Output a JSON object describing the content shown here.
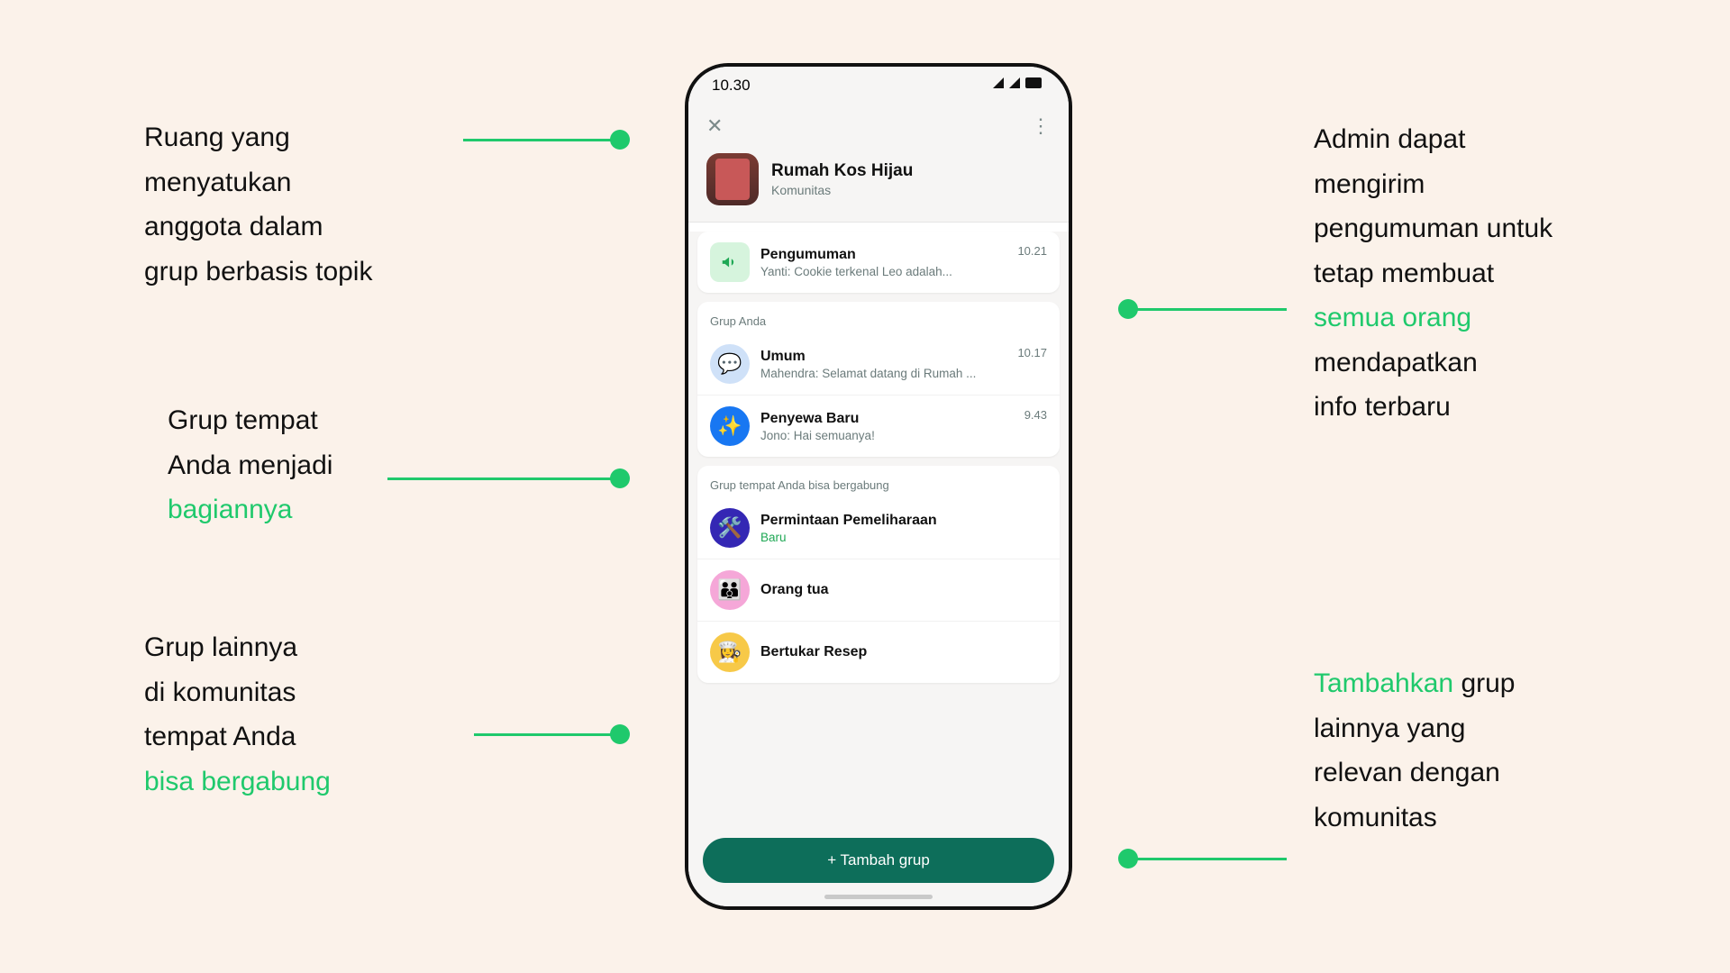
{
  "annotations": {
    "a1": {
      "pre": "Ruang yang\nmenyatukan\nanggota dalam\ngrup berbasis topik",
      "hl": "",
      "post": ""
    },
    "a2": {
      "pre": "Grup tempat\nAnda menjadi\n",
      "hl": "bagiannya",
      "post": ""
    },
    "a3": {
      "pre": "Grup lainnya\ndi komunitas\ntempat Anda\n",
      "hl": "bisa bergabung",
      "post": ""
    },
    "a4": {
      "pre": "Admin dapat\nmengirim\npengumuman untuk\ntetap membuat\n",
      "hl": "semua orang",
      "post": "\nmendapatkan\ninfo terbaru"
    },
    "a5": {
      "pre": "",
      "hl": "Tambahkan",
      "post": " grup\nlainnya yang\nrelevan dengan\nkomunitas"
    }
  },
  "status": {
    "time": "10.30"
  },
  "community": {
    "title": "Rumah Kos Hijau",
    "subtitle": "Komunitas"
  },
  "announcements": {
    "title": "Pengumuman",
    "preview": "Yanti: Cookie terkenal Leo adalah...",
    "time": "10.21"
  },
  "yourGroups": {
    "header": "Grup Anda",
    "items": [
      {
        "title": "Umum",
        "preview": "Mahendra: Selamat datang di Rumah ...",
        "time": "10.17"
      },
      {
        "title": "Penyewa Baru",
        "preview": "Jono: Hai semuanya!",
        "time": "9.43"
      }
    ]
  },
  "joinable": {
    "header": "Grup tempat Anda bisa bergabung",
    "items": [
      {
        "title": "Permintaan Pemeliharaan",
        "badge": "Baru"
      },
      {
        "title": "Orang tua"
      },
      {
        "title": "Bertukar Resep"
      }
    ]
  },
  "cta": {
    "label": "+ Tambah grup"
  }
}
